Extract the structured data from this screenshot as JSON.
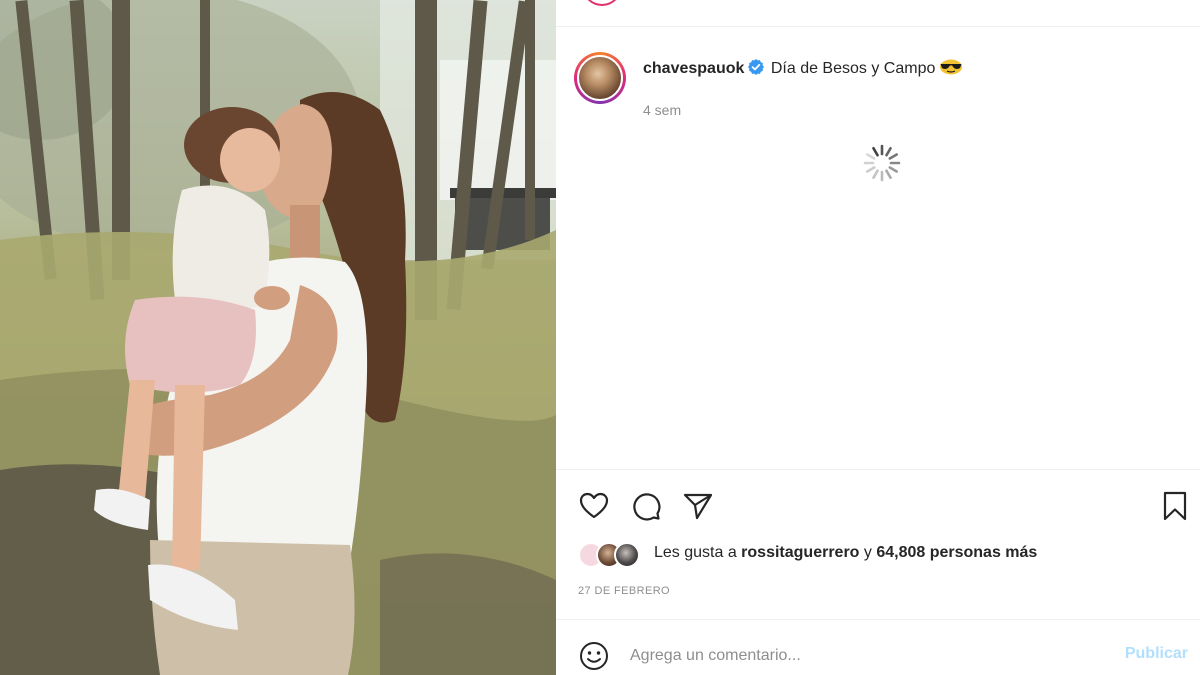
{
  "post": {
    "username": "chavespauok",
    "caption": "Día de Besos y Campo",
    "emoji": "sunglasses-emoji",
    "time_ago": "4 sem",
    "verified": true
  },
  "actions": {
    "like_icon": "heart-icon",
    "comment_icon": "comment-icon",
    "share_icon": "send-icon",
    "save_icon": "bookmark-icon"
  },
  "likes": {
    "prefix": "Les gusta a ",
    "user": "rossitaguerrero",
    "connector": " y ",
    "count": "64,808 personas más"
  },
  "date": "27 DE FEBRERO",
  "comment": {
    "placeholder": "Agrega un comentario...",
    "publish_label": "Publicar"
  },
  "colors": {
    "verified": "#3897f0",
    "publish_disabled": "#b2dffc",
    "secondary_text": "#8e8e8e"
  }
}
